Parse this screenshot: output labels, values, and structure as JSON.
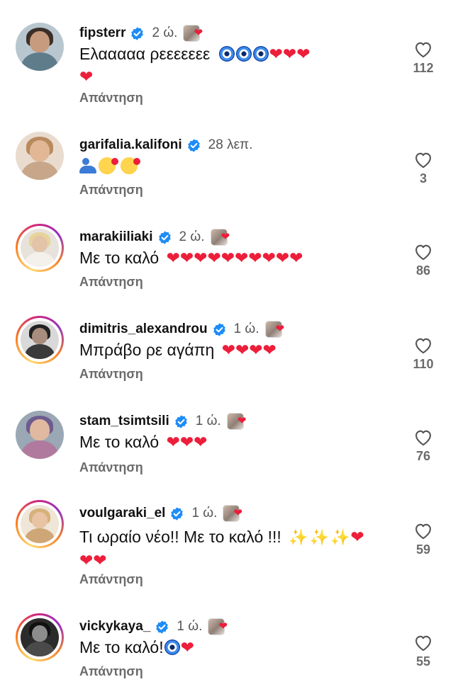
{
  "reply_label": "Απάντηση",
  "colors": {
    "heart": "#ed1e3a",
    "verified": "#1d8cf8",
    "muted": "#6b6b6b"
  },
  "comments": [
    {
      "username": "fipsterr",
      "time": "2 ώ.",
      "verified": true,
      "liked_by_creator": true,
      "story_ring": false,
      "text_line1": "Ελααααα ρεεεεεεε",
      "emoji_line1": [
        "nazar",
        "nazar",
        "nazar",
        "heart",
        "heart",
        "heart"
      ],
      "emoji_line2": [
        "heart"
      ],
      "likes": "112"
    },
    {
      "username": "garifalia.kalifoni",
      "time": "28 λεπ.",
      "verified": true,
      "liked_by_creator": false,
      "story_ring": false,
      "text_line1": "",
      "emoji_line1": [
        "people",
        "smiling-face-hearts",
        "smiling-face-hearts"
      ],
      "likes": "3"
    },
    {
      "username": "marakiiliaki",
      "time": "2 ώ.",
      "verified": true,
      "liked_by_creator": true,
      "story_ring": true,
      "text_line1": "Με το καλό",
      "emoji_line1": [
        "heart",
        "heart",
        "heart",
        "heart",
        "heart",
        "heart",
        "heart",
        "heart",
        "heart",
        "heart"
      ],
      "likes": "86"
    },
    {
      "username": "dimitris_alexandrou",
      "time": "1 ώ.",
      "verified": true,
      "liked_by_creator": true,
      "story_ring": true,
      "text_line1": "Μπράβο ρε αγάπη",
      "emoji_line1": [
        "heart",
        "heart",
        "heart",
        "heart"
      ],
      "likes": "110"
    },
    {
      "username": "stam_tsimtsili",
      "time": "1 ώ.",
      "verified": true,
      "liked_by_creator": true,
      "story_ring": false,
      "text_line1": "Με το καλό",
      "emoji_line1": [
        "heart",
        "heart",
        "heart"
      ],
      "likes": "76"
    },
    {
      "username": "voulgaraki_el",
      "time": "1 ώ.",
      "verified": true,
      "liked_by_creator": true,
      "story_ring": true,
      "text_line1": "Τι ωραίο νέο!! Με το καλό !!!",
      "emoji_line1": [
        "dizzy",
        "dizzy",
        "dizzy",
        "heart"
      ],
      "emoji_line2": [
        "heart",
        "heart"
      ],
      "likes": "59"
    },
    {
      "username": "vickykaya_",
      "time": "1 ώ.",
      "verified": true,
      "liked_by_creator": true,
      "story_ring": true,
      "text_line1": "Με το καλό!",
      "emoji_line1": [
        "nazar",
        "heart"
      ],
      "likes": "55"
    }
  ]
}
